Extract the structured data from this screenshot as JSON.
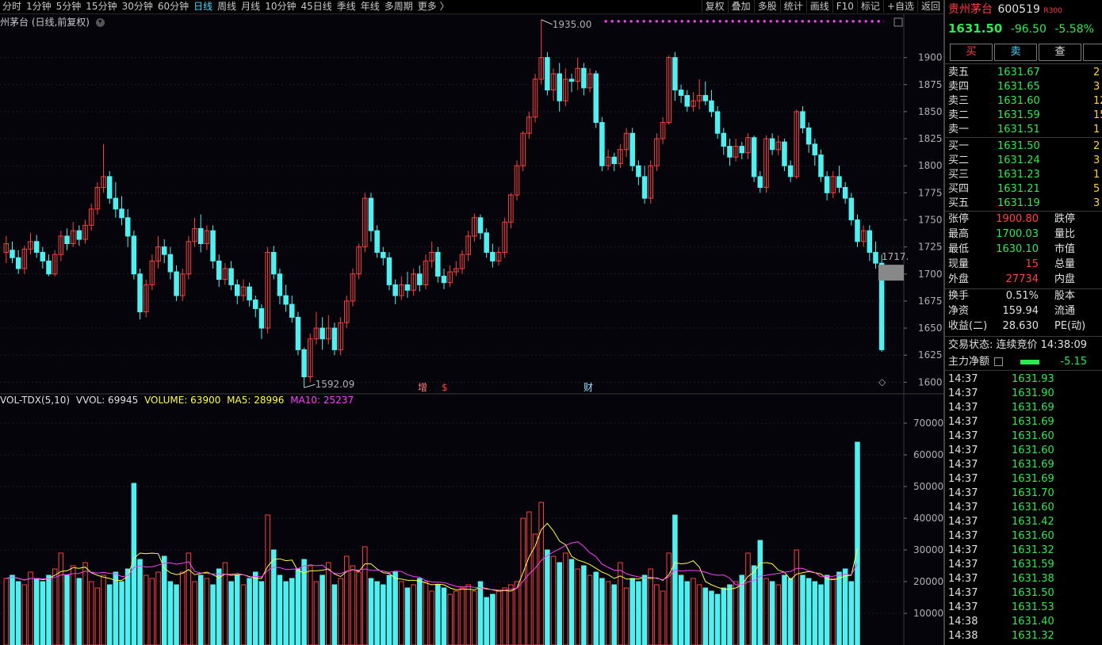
{
  "toolbar": {
    "periods": [
      "分时",
      "1分钟",
      "5分钟",
      "15分钟",
      "30分钟",
      "60分钟",
      "日线",
      "周线",
      "月线",
      "10分钟",
      "45日线",
      "季线",
      "年线",
      "多周期",
      "更多 〉"
    ],
    "active_period": "日线",
    "tools": [
      "复权",
      "叠加",
      "多股",
      "统计",
      "画线",
      "F10",
      "标记",
      "+自选",
      "返回"
    ]
  },
  "chart_title": "州茅台 (日线,前复权)",
  "price_axis": [
    "1900",
    "1875",
    "1850",
    "1825",
    "1800",
    "1775",
    "1750",
    "1725",
    "1700",
    "1675",
    "1650",
    "1625",
    "1600"
  ],
  "high_marker": "1935.00",
  "low_marker": "1592.09",
  "last_price_tag": "1717.",
  "event_markers": [
    "增",
    "$",
    "财"
  ],
  "volume_legend": {
    "name": "VOL-TDX(5,10)",
    "vvol": "VVOL: 69945",
    "volume": "VOLUME: 63900",
    "ma5": "MA5: 28996",
    "ma10": "MA10: 25237"
  },
  "volume_axis": [
    "70000",
    "60000",
    "50000",
    "40000",
    "30000",
    "20000",
    "10000"
  ],
  "colors": {
    "up": "#ff4040",
    "down": "#4ef0f0",
    "ma5": "#ffff40",
    "ma10": "#ff40ff",
    "vvol": "#ffffff"
  },
  "panel": {
    "stock_name": "贵州茅台",
    "stock_code": "600519",
    "badge": "R300",
    "price": "1631.50",
    "change": "-96.50",
    "change_pct": "-5.58%",
    "buttons": [
      "买",
      "卖",
      "查"
    ],
    "asks": [
      {
        "label": "卖五",
        "price": "1631.67",
        "vol": "2"
      },
      {
        "label": "卖四",
        "price": "1631.65",
        "vol": "3"
      },
      {
        "label": "卖三",
        "price": "1631.60",
        "vol": "12"
      },
      {
        "label": "卖二",
        "price": "1631.59",
        "vol": "15"
      },
      {
        "label": "卖一",
        "price": "1631.51",
        "vol": "1"
      }
    ],
    "bids": [
      {
        "label": "买一",
        "price": "1631.50",
        "vol": "2"
      },
      {
        "label": "买二",
        "price": "1631.24",
        "vol": "3"
      },
      {
        "label": "买三",
        "price": "1631.23",
        "vol": "1"
      },
      {
        "label": "买四",
        "price": "1631.21",
        "vol": "5"
      },
      {
        "label": "买五",
        "price": "1631.19",
        "vol": "3"
      }
    ],
    "stats": [
      {
        "label": "张停",
        "value": "1900.80",
        "value2": "跌停"
      },
      {
        "label": "最高",
        "value": "1700.03",
        "value2": "量比"
      },
      {
        "label": "最低",
        "value": "1630.10",
        "value2": "市值"
      },
      {
        "label": "现量",
        "value": "15",
        "value2": "总量"
      },
      {
        "label": "外盘",
        "value": "27734",
        "value2": "内盘"
      }
    ],
    "finance": [
      {
        "label": "换手",
        "value": "0.51%",
        "value2": "股本"
      },
      {
        "label": "净资",
        "value": "159.94",
        "value2": "流通"
      },
      {
        "label": "收益(二)",
        "value": "28.630",
        "value2": "PE(动)"
      }
    ],
    "trade_status": "交易状态: 连续竞价 14:38:09",
    "main_net_label": "主力净额",
    "main_net_value": "-5.15",
    "ticks": [
      {
        "time": "14:37",
        "price": "1631.93"
      },
      {
        "time": "14:37",
        "price": "1631.90"
      },
      {
        "time": "14:37",
        "price": "1631.69"
      },
      {
        "time": "14:37",
        "price": "1631.69"
      },
      {
        "time": "14:37",
        "price": "1631.60"
      },
      {
        "time": "14:37",
        "price": "1631.60"
      },
      {
        "time": "14:37",
        "price": "1631.69"
      },
      {
        "time": "14:37",
        "price": "1631.69"
      },
      {
        "time": "14:37",
        "price": "1631.70"
      },
      {
        "time": "14:37",
        "price": "1631.60"
      },
      {
        "time": "14:37",
        "price": "1631.42"
      },
      {
        "time": "14:37",
        "price": "1631.60"
      },
      {
        "time": "14:37",
        "price": "1631.32"
      },
      {
        "time": "14:37",
        "price": "1631.59"
      },
      {
        "time": "14:37",
        "price": "1631.38"
      },
      {
        "time": "14:37",
        "price": "1631.50"
      },
      {
        "time": "14:37",
        "price": "1631.53"
      },
      {
        "time": "14:38",
        "price": "1631.40"
      },
      {
        "time": "14:38",
        "price": "1631.32"
      }
    ]
  },
  "chart_data": {
    "type": "candlestick",
    "y_range": [
      1590,
      1940
    ],
    "volume_range": [
      0,
      72000
    ],
    "candles": [
      [
        1720,
        1728,
        1710,
        1735
      ],
      [
        1722,
        1715,
        1710,
        1730
      ],
      [
        1715,
        1705,
        1700,
        1722
      ],
      [
        1705,
        1723,
        1700,
        1726
      ],
      [
        1723,
        1730,
        1718,
        1738
      ],
      [
        1730,
        1720,
        1715,
        1736
      ],
      [
        1720,
        1712,
        1705,
        1725
      ],
      [
        1712,
        1700,
        1698,
        1718
      ],
      [
        1700,
        1718,
        1698,
        1722
      ],
      [
        1718,
        1735,
        1712,
        1740
      ],
      [
        1735,
        1728,
        1722,
        1742
      ],
      [
        1728,
        1740,
        1725,
        1748
      ],
      [
        1740,
        1732,
        1726,
        1745
      ],
      [
        1732,
        1745,
        1728,
        1750
      ],
      [
        1745,
        1760,
        1740,
        1765
      ],
      [
        1760,
        1780,
        1755,
        1785
      ],
      [
        1780,
        1790,
        1775,
        1820
      ],
      [
        1790,
        1770,
        1765,
        1795
      ],
      [
        1770,
        1760,
        1752,
        1785
      ],
      [
        1760,
        1752,
        1745,
        1772
      ],
      [
        1752,
        1735,
        1725,
        1760
      ],
      [
        1735,
        1700,
        1695,
        1740
      ],
      [
        1700,
        1665,
        1658,
        1705
      ],
      [
        1665,
        1690,
        1660,
        1695
      ],
      [
        1690,
        1712,
        1685,
        1718
      ],
      [
        1712,
        1725,
        1705,
        1735
      ],
      [
        1725,
        1718,
        1710,
        1732
      ],
      [
        1718,
        1702,
        1695,
        1725
      ],
      [
        1702,
        1680,
        1675,
        1708
      ],
      [
        1680,
        1700,
        1675,
        1705
      ],
      [
        1700,
        1730,
        1695,
        1735
      ],
      [
        1730,
        1742,
        1725,
        1752
      ],
      [
        1742,
        1728,
        1720,
        1755
      ],
      [
        1728,
        1740,
        1722,
        1745
      ],
      [
        1740,
        1712,
        1705,
        1745
      ],
      [
        1712,
        1695,
        1688,
        1718
      ],
      [
        1695,
        1705,
        1690,
        1710
      ],
      [
        1705,
        1690,
        1685,
        1712
      ],
      [
        1690,
        1680,
        1672,
        1695
      ],
      [
        1680,
        1688,
        1675,
        1695
      ],
      [
        1688,
        1676,
        1670,
        1692
      ],
      [
        1676,
        1668,
        1660,
        1680
      ],
      [
        1668,
        1650,
        1640,
        1672
      ],
      [
        1650,
        1720,
        1645,
        1725
      ],
      [
        1720,
        1700,
        1695,
        1726
      ],
      [
        1700,
        1680,
        1672,
        1705
      ],
      [
        1680,
        1672,
        1665,
        1690
      ],
      [
        1672,
        1660,
        1655,
        1680
      ],
      [
        1660,
        1630,
        1625,
        1665
      ],
      [
        1630,
        1605,
        1595,
        1632
      ],
      [
        1605,
        1640,
        1600,
        1645
      ],
      [
        1640,
        1650,
        1635,
        1665
      ],
      [
        1650,
        1640,
        1630,
        1660
      ],
      [
        1640,
        1650,
        1635,
        1662
      ],
      [
        1650,
        1630,
        1625,
        1655
      ],
      [
        1630,
        1655,
        1625,
        1660
      ],
      [
        1655,
        1675,
        1650,
        1680
      ],
      [
        1675,
        1700,
        1670,
        1705
      ],
      [
        1700,
        1725,
        1695,
        1728
      ],
      [
        1725,
        1770,
        1720,
        1775
      ],
      [
        1770,
        1740,
        1730,
        1775
      ],
      [
        1740,
        1720,
        1715,
        1745
      ],
      [
        1720,
        1715,
        1708,
        1725
      ],
      [
        1715,
        1690,
        1685,
        1720
      ],
      [
        1690,
        1680,
        1672,
        1695
      ],
      [
        1680,
        1690,
        1676,
        1698
      ],
      [
        1690,
        1685,
        1678,
        1702
      ],
      [
        1685,
        1700,
        1680,
        1705
      ],
      [
        1700,
        1690,
        1684,
        1708
      ],
      [
        1690,
        1712,
        1686,
        1718
      ],
      [
        1712,
        1720,
        1706,
        1730
      ],
      [
        1720,
        1698,
        1692,
        1725
      ],
      [
        1698,
        1692,
        1686,
        1705
      ],
      [
        1692,
        1702,
        1688,
        1708
      ],
      [
        1702,
        1705,
        1698,
        1712
      ],
      [
        1705,
        1718,
        1700,
        1722
      ],
      [
        1718,
        1735,
        1712,
        1740
      ],
      [
        1735,
        1752,
        1730,
        1756
      ],
      [
        1752,
        1738,
        1732,
        1755
      ],
      [
        1738,
        1720,
        1715,
        1742
      ],
      [
        1720,
        1712,
        1706,
        1728
      ],
      [
        1712,
        1720,
        1708,
        1725
      ],
      [
        1720,
        1748,
        1715,
        1752
      ],
      [
        1748,
        1773,
        1742,
        1775
      ],
      [
        1773,
        1800,
        1768,
        1805
      ],
      [
        1800,
        1830,
        1795,
        1832
      ],
      [
        1830,
        1845,
        1825,
        1850
      ],
      [
        1845,
        1880,
        1840,
        1885
      ],
      [
        1880,
        1900,
        1875,
        1935
      ],
      [
        1900,
        1870,
        1865,
        1905
      ],
      [
        1870,
        1885,
        1860,
        1890
      ],
      [
        1885,
        1860,
        1850,
        1895
      ],
      [
        1860,
        1880,
        1855,
        1890
      ],
      [
        1880,
        1878,
        1868,
        1885
      ],
      [
        1878,
        1890,
        1870,
        1900
      ],
      [
        1890,
        1872,
        1865,
        1895
      ],
      [
        1872,
        1885,
        1868,
        1890
      ],
      [
        1885,
        1840,
        1835,
        1888
      ],
      [
        1840,
        1800,
        1795,
        1845
      ],
      [
        1800,
        1808,
        1796,
        1815
      ],
      [
        1808,
        1802,
        1795,
        1812
      ],
      [
        1802,
        1815,
        1798,
        1820
      ],
      [
        1815,
        1830,
        1808,
        1835
      ],
      [
        1830,
        1800,
        1795,
        1835
      ],
      [
        1800,
        1790,
        1782,
        1805
      ],
      [
        1790,
        1770,
        1765,
        1800
      ],
      [
        1770,
        1800,
        1765,
        1805
      ],
      [
        1800,
        1825,
        1795,
        1830
      ],
      [
        1825,
        1840,
        1820,
        1845
      ],
      [
        1840,
        1900,
        1838,
        1902
      ],
      [
        1900,
        1870,
        1860,
        1905
      ],
      [
        1870,
        1865,
        1858,
        1875
      ],
      [
        1865,
        1855,
        1850,
        1870
      ],
      [
        1855,
        1860,
        1850,
        1868
      ],
      [
        1860,
        1865,
        1852,
        1880
      ],
      [
        1865,
        1860,
        1856,
        1878
      ],
      [
        1860,
        1850,
        1845,
        1870
      ],
      [
        1850,
        1830,
        1825,
        1855
      ],
      [
        1830,
        1818,
        1810,
        1835
      ],
      [
        1818,
        1808,
        1800,
        1825
      ],
      [
        1808,
        1818,
        1804,
        1825
      ],
      [
        1818,
        1812,
        1806,
        1822
      ],
      [
        1812,
        1826,
        1806,
        1830
      ],
      [
        1826,
        1790,
        1785,
        1828
      ],
      [
        1790,
        1780,
        1775,
        1795
      ],
      [
        1780,
        1825,
        1775,
        1828
      ],
      [
        1825,
        1815,
        1810,
        1830
      ],
      [
        1815,
        1822,
        1810,
        1828
      ],
      [
        1822,
        1800,
        1795,
        1825
      ],
      [
        1800,
        1790,
        1785,
        1805
      ],
      [
        1790,
        1850,
        1788,
        1852
      ],
      [
        1850,
        1835,
        1830,
        1855
      ],
      [
        1835,
        1820,
        1812,
        1840
      ],
      [
        1820,
        1810,
        1800,
        1825
      ],
      [
        1810,
        1790,
        1785,
        1815
      ],
      [
        1790,
        1775,
        1768,
        1795
      ],
      [
        1775,
        1790,
        1770,
        1795
      ],
      [
        1790,
        1780,
        1775,
        1800
      ],
      [
        1780,
        1770,
        1765,
        1785
      ],
      [
        1770,
        1750,
        1745,
        1775
      ],
      [
        1750,
        1730,
        1725,
        1755
      ],
      [
        1730,
        1740,
        1725,
        1745
      ],
      [
        1740,
        1720,
        1712,
        1745
      ],
      [
        1720,
        1710,
        1705,
        1730
      ],
      [
        1710,
        1630,
        1628,
        1718
      ]
    ],
    "volumes": [
      21000,
      22000,
      20000,
      19000,
      23000,
      21000,
      20000,
      22000,
      24000,
      29000,
      22000,
      25000,
      21000,
      26000,
      20000,
      18000,
      22000,
      19000,
      23000,
      20000,
      24000,
      51000,
      27000,
      22000,
      21000,
      23000,
      28000,
      20000,
      19000,
      23000,
      29000,
      20000,
      22000,
      21000,
      19000,
      24000,
      26000,
      20000,
      22000,
      19000,
      21000,
      23000,
      20000,
      41000,
      30000,
      22000,
      20000,
      21000,
      24000,
      27000,
      25000,
      20000,
      22000,
      26000,
      19000,
      21000,
      28000,
      25000,
      23000,
      31000,
      21000,
      20000,
      19000,
      22000,
      23000,
      20000,
      18000,
      19000,
      21000,
      20000,
      17000,
      19000,
      18000,
      16000,
      17000,
      18000,
      19000,
      17000,
      20000,
      15000,
      16000,
      17000,
      18000,
      19000,
      20000,
      40000,
      42000,
      35000,
      45000,
      30000,
      28000,
      26000,
      29000,
      27000,
      24000,
      25000,
      22000,
      23000,
      21000,
      20000,
      19000,
      26000,
      18000,
      21000,
      20000,
      22000,
      24000,
      19000,
      17000,
      29000,
      41000,
      22000,
      20000,
      21000,
      19000,
      18000,
      17000,
      16000,
      18000,
      19000,
      20000,
      22000,
      29000,
      25000,
      33000,
      21000,
      20000,
      19000,
      22000,
      21000,
      30000,
      22000,
      21000,
      20000,
      19000,
      22000,
      21000,
      23000,
      24000,
      20000,
      64000
    ]
  }
}
